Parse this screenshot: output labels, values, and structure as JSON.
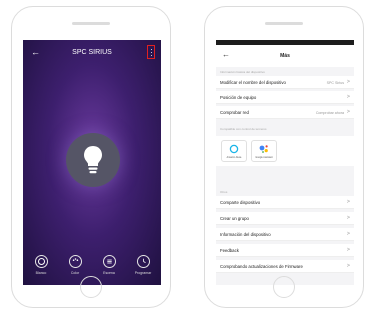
{
  "left_screen": {
    "header": {
      "back_icon": "←",
      "title": "SPC SIRIUS",
      "more_icon": "more-vertical-icon"
    },
    "center_icon": "lightbulb-icon",
    "bottom_actions": [
      {
        "label": "Blanco",
        "icon": "white-light-icon"
      },
      {
        "label": "Color",
        "icon": "color-palette-icon"
      },
      {
        "label": "Escena",
        "icon": "scene-icon"
      },
      {
        "label": "Programar",
        "icon": "clock-icon"
      }
    ],
    "colors": {
      "bg_center": "#6a3a9e",
      "bg_edge": "#1f1140",
      "highlight_border": "#e02020"
    }
  },
  "right_screen": {
    "header": {
      "back_icon": "←",
      "title": "Más"
    },
    "section1_label": "Información básica del dispositivo",
    "basic_rows": [
      {
        "label": "Modificar el nombre del dispositivo",
        "value": "SPC Sirius"
      },
      {
        "label": "Posición de equipo",
        "value": ""
      },
      {
        "label": "Comprobar red",
        "value": "Comprobar ahora"
      }
    ],
    "section2_label": "Compatible con control de terceros",
    "assistants": [
      {
        "label": "Amazon Alexa",
        "icon": "alexa-icon"
      },
      {
        "label": "Google Assistant",
        "icon": "google-assistant-icon"
      }
    ],
    "section3_label": "Otros",
    "other_rows": [
      {
        "label": "Comparte dispositivo"
      },
      {
        "label": "Crear un grupo"
      },
      {
        "label": "Información del dispositivo"
      },
      {
        "label": "Feedback"
      },
      {
        "label": "Comprobando actualizaciones de Firmware"
      }
    ],
    "chevron": ">"
  }
}
